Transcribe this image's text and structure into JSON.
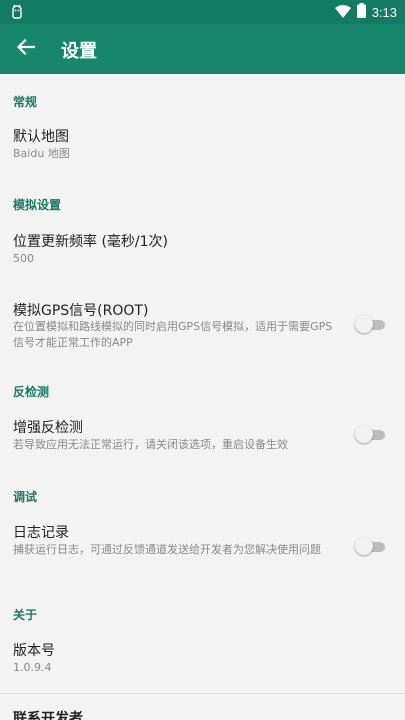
{
  "status_bar": {
    "time": "3:13",
    "left_icon": "android-debug-icon",
    "wifi_icon": "wifi-icon",
    "battery_icon": "battery-icon"
  },
  "app_bar": {
    "title": "设置",
    "back_icon": "arrow-left-icon"
  },
  "colors": {
    "status_bar": "#137a63",
    "app_bar": "#16876c",
    "section_header": "#1a7a63",
    "background": "#f3f3f3"
  },
  "sections": {
    "general": {
      "header": "常规",
      "default_map": {
        "title": "默认地图",
        "summary": "Baidu 地图"
      }
    },
    "simulation": {
      "header": "模拟设置",
      "update_frequency": {
        "title": "位置更新频率 (毫秒/1次)",
        "summary": "500"
      },
      "gps_signal": {
        "title": "模拟GPS信号(ROOT)",
        "summary": "在位置模拟和路线模拟的同时启用GPS信号模拟，适用于需要GPS信号才能正常工作的APP",
        "enabled": false
      }
    },
    "anti_detection": {
      "header": "反检测",
      "enhanced": {
        "title": "增强反检测",
        "summary": "若导致应用无法正常运行，请关闭该选项，重启设备生效",
        "enabled": false
      }
    },
    "debug": {
      "header": "调试",
      "logging": {
        "title": "日志记录",
        "summary": "捕获运行日志，可通过反馈通道发送给开发者为您解决使用问题",
        "enabled": false
      }
    },
    "about": {
      "header": "关于",
      "version": {
        "title": "版本号",
        "summary": "1.0.9.4"
      },
      "contact": {
        "title": "联系开发者"
      }
    }
  }
}
